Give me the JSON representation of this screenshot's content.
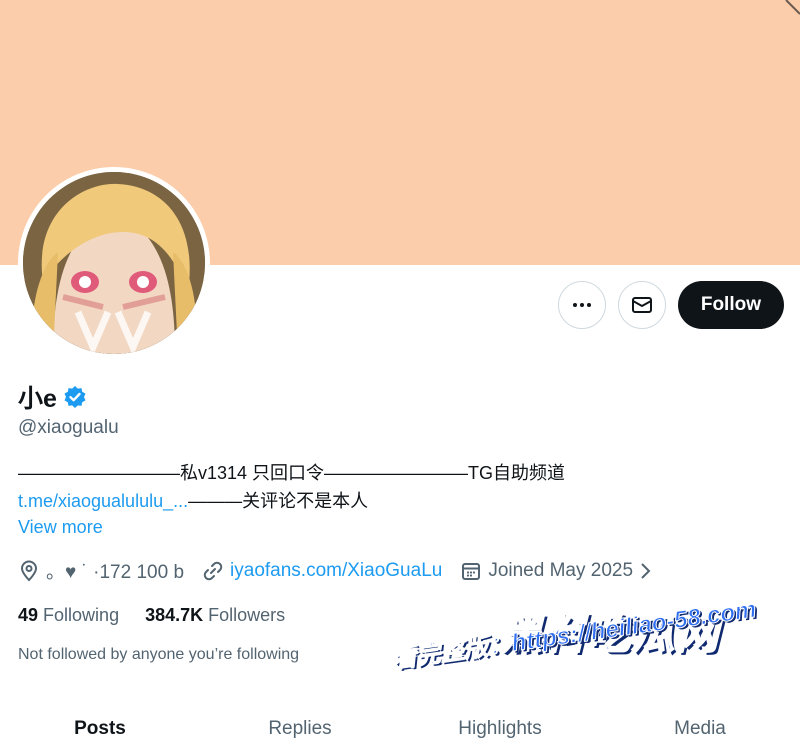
{
  "profile": {
    "display_name": "小e",
    "handle": "@xiaogualu",
    "bio_part1": "—————————私v1314 只回口令————————TG自助频道",
    "bio_link": "t.me/xiaogualululu_...",
    "bio_part2": "———关评论不是本人",
    "view_more": "View more",
    "location": "。♥ ˙ ·172 100 b",
    "website": "iyaofans.com/XiaoGuaLu",
    "joined": "Joined May 2025",
    "following_count": "49",
    "following_label": "Following",
    "followers_count": "384.7K",
    "followers_label": "Followers",
    "not_followed": "Not followed by anyone you’re following"
  },
  "actions": {
    "more_icon": "more-icon",
    "message_icon": "mail-icon",
    "follow_label": "Follow"
  },
  "tabs": [
    {
      "label": "Posts"
    },
    {
      "label": "Replies"
    },
    {
      "label": "Highlights"
    },
    {
      "label": "Media"
    }
  ],
  "watermark": {
    "title": "黑料吃瓜网",
    "url": "看完整版：https://heiliao-58.com"
  },
  "colors": {
    "banner": "#fccdaa",
    "accent": "#1d9bf0",
    "verified": "#1d9bf0",
    "text_primary": "#0f1419",
    "text_secondary": "#536471"
  }
}
